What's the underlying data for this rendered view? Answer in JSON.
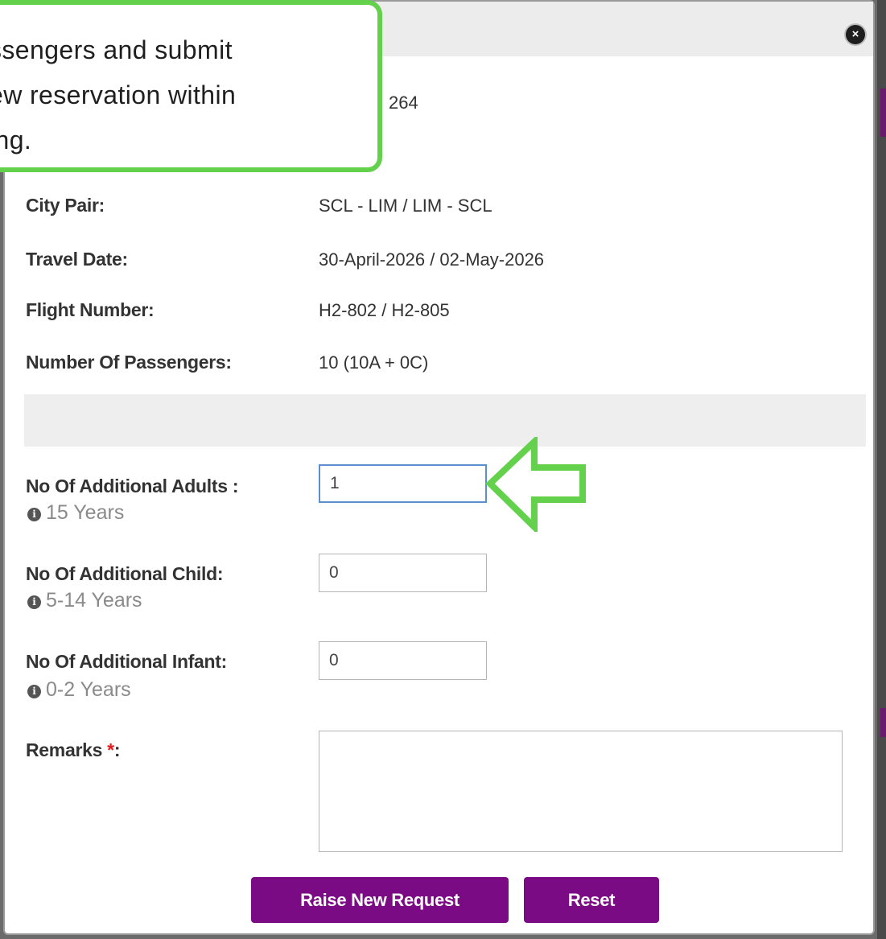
{
  "callout": {
    "lines": [
      "ssengers and submit",
      "ew reservation within",
      "ing."
    ]
  },
  "header": {
    "close_icon": "×",
    "partial_value": "264"
  },
  "details": [
    {
      "label": "City Pair:",
      "value": "SCL - LIM / LIM - SCL"
    },
    {
      "label": "Travel Date:",
      "value": "30-April-2026 / 02-May-2026"
    },
    {
      "label": "Flight Number:",
      "value": "H2-802 / H2-805"
    },
    {
      "label": "Number Of Passengers:",
      "value": "10 (10A + 0C)"
    }
  ],
  "form": {
    "adults": {
      "label": "No Of Additional Adults :",
      "hint": "15 Years",
      "value": "1"
    },
    "child": {
      "label": "No Of Additional Child:",
      "hint": "5-14 Years",
      "value": "0"
    },
    "infant": {
      "label": "No Of Additional Infant:",
      "hint": "0-2 Years",
      "value": "0"
    },
    "remarks": {
      "label": "Remarks",
      "required_mark": "*",
      "suffix": ":",
      "value": ""
    }
  },
  "buttons": {
    "raise": "Raise New Request",
    "reset": "Reset"
  },
  "icons": {
    "info": "i",
    "close": "close-circle-icon",
    "arrow": "left-arrow-outline-icon"
  },
  "colors": {
    "accent": "#7b0b84",
    "callout_border": "#63d14c",
    "required": "#e21b1b"
  }
}
